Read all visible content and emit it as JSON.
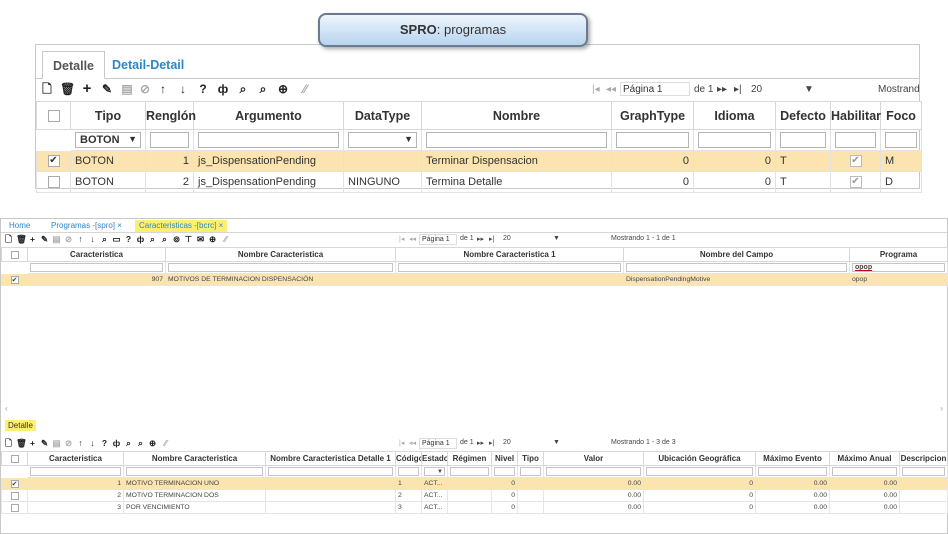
{
  "tooltip": {
    "bold": "SPRO",
    "rest": ": programas"
  },
  "top_panel": {
    "tabs": [
      {
        "label": "Detalle"
      },
      {
        "label": "Detail-Detail"
      }
    ],
    "pager": {
      "first": "|◂",
      "prev": "◂◂",
      "page_label": "Página 1",
      "of": "de 1",
      "next": "▸▸",
      "last": "▸|",
      "page_size": "20",
      "showing": "Mostrand"
    },
    "columns": [
      "",
      "Tipo",
      "Renglón",
      "Argumento",
      "DataType",
      "Nombre",
      "GraphType",
      "Idioma",
      "Defecto",
      "Habilitar",
      "Foco"
    ],
    "filter": {
      "tipo": "BOTON",
      "dropdown_arrow": "▼"
    },
    "rows": [
      {
        "checked": "✔",
        "tipo": "BOTON",
        "renglon": "1",
        "argumento": "js_DispensationPending",
        "datatype": "",
        "nombre": "Terminar Dispensacion",
        "graphtype": "0",
        "idioma": "0",
        "defecto": "T",
        "habilitar": "✔",
        "foco": "M"
      },
      {
        "checked": "",
        "tipo": "BOTON",
        "renglon": "2",
        "argumento": "js_DispensationPending",
        "datatype": "NINGUNO",
        "nombre": "Termina Detalle",
        "graphtype": "0",
        "idioma": "0",
        "defecto": "T",
        "habilitar": "✔",
        "foco": "D"
      }
    ]
  },
  "bottom_panel": {
    "nav_tabs": [
      {
        "label": "Home"
      },
      {
        "label": "Programas -[spro] ×"
      },
      {
        "label": "Caracteristicas -[bcrc] ×"
      }
    ],
    "pager": {
      "first": "|◂",
      "prev": "◂◂",
      "page_label": "Página 1",
      "of": "de 1",
      "next": "▸▸",
      "last": "▸|",
      "page_size": "20",
      "showing": "Mostrando 1 - 1 de 1"
    },
    "columns": [
      "",
      "Caracteristica",
      "Nombre Caracteristica",
      "Nombre Caracteristica 1",
      "Nombre del Campo",
      "Programa"
    ],
    "filter": {
      "programa": "opop"
    },
    "rows": [
      {
        "checked": "✔",
        "caracteristica": "907",
        "nombre": "MOTIVOS DE TERMINACION DISPENSACIÓN",
        "nombre1": "",
        "campo": "DispensationPendingMotive",
        "programa": "opop"
      }
    ],
    "detalle": {
      "tab_label": "Detalle",
      "pager": {
        "first": "|◂",
        "prev": "◂◂",
        "page_label": "Página 1",
        "of": "de 1",
        "next": "▸▸",
        "last": "▸|",
        "page_size": "20",
        "showing": "Mostrando 1 - 3 de 3"
      },
      "columns": [
        "",
        "Caracteristica",
        "Nombre Caracteristica",
        "Nombre Caracteristica Detalle 1",
        "Código",
        "Estado",
        "Régimen",
        "Nivel",
        "Tipo",
        "Valor",
        "Ubicación Geográfica",
        "Máximo Evento",
        "Máximo Anual",
        "Descripcion"
      ],
      "rows": [
        {
          "checked": "✔",
          "caracteristica": "1",
          "nombre": "MOTIVO TERMINACION UNO",
          "detalle1": "",
          "codigo": "1",
          "estado": "ACT...",
          "regimen": "",
          "nivel": "0",
          "tipo": "",
          "valor": "0.00",
          "ubicacion": "0",
          "max_evento": "0.00",
          "max_anual": "0.00",
          "descripcion": ""
        },
        {
          "checked": "",
          "caracteristica": "2",
          "nombre": "MOTIVO TERMINACION DOS",
          "detalle1": "",
          "codigo": "2",
          "estado": "ACT...",
          "regimen": "",
          "nivel": "0",
          "tipo": "",
          "valor": "0.00",
          "ubicacion": "0",
          "max_evento": "0.00",
          "max_anual": "0.00",
          "descripcion": ""
        },
        {
          "checked": "",
          "caracteristica": "3",
          "nombre": "POR VENCIMIENTO",
          "detalle1": "",
          "codigo": "3",
          "estado": "ACT...",
          "regimen": "",
          "nivel": "0",
          "tipo": "",
          "valor": "0.00",
          "ubicacion": "0",
          "max_evento": "0.00",
          "max_anual": "0.00",
          "descripcion": ""
        }
      ]
    }
  },
  "colors": {
    "selected_row": "#fbe4b0",
    "link_blue": "#2a87c9",
    "highlight_yellow": "#ffef6e"
  }
}
